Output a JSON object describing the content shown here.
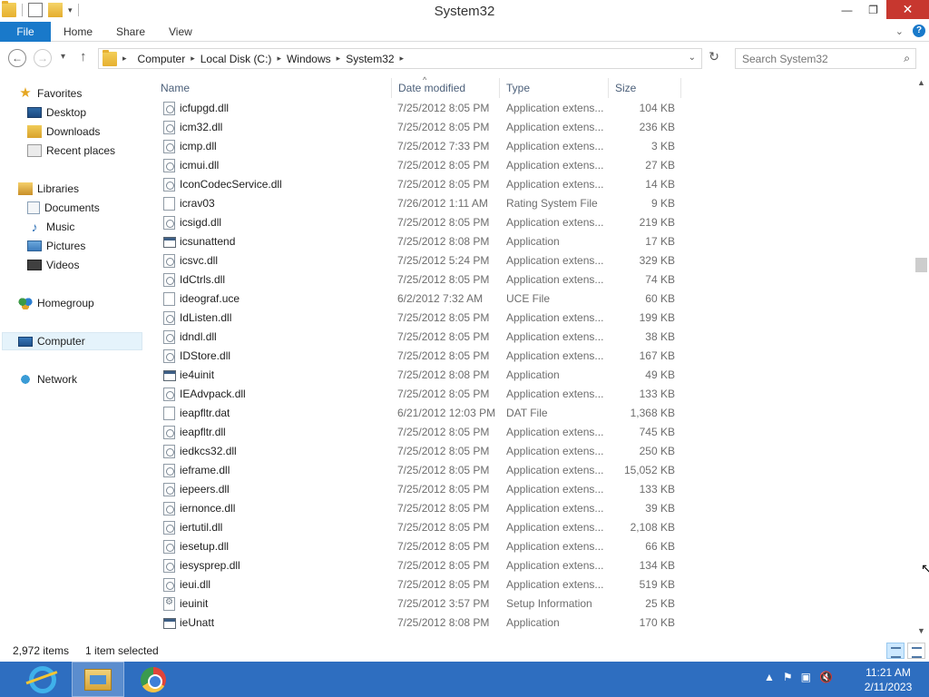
{
  "window": {
    "title": "System32",
    "controls": {
      "minimize": "—",
      "restore": "❐",
      "close": "✕"
    }
  },
  "ribbon": {
    "tabs": [
      {
        "label": "File"
      },
      {
        "label": "Home"
      },
      {
        "label": "Share"
      },
      {
        "label": "View"
      }
    ]
  },
  "address": {
    "crumbs": [
      "Computer",
      "Local Disk (C:)",
      "Windows",
      "System32"
    ]
  },
  "search": {
    "placeholder": "Search System32"
  },
  "nav": {
    "favorites": "Favorites",
    "desktop": "Desktop",
    "downloads": "Downloads",
    "recent": "Recent places",
    "libraries": "Libraries",
    "documents": "Documents",
    "music": "Music",
    "pictures": "Pictures",
    "videos": "Videos",
    "homegroup": "Homegroup",
    "computer": "Computer",
    "network": "Network"
  },
  "columns": {
    "name": "Name",
    "date": "Date modified",
    "type": "Type",
    "size": "Size"
  },
  "files": [
    {
      "name": "icfupgd.dll",
      "date": "7/25/2012 8:05 PM",
      "type": "Application extens...",
      "size": "104 KB",
      "icon": "dll"
    },
    {
      "name": "icm32.dll",
      "date": "7/25/2012 8:05 PM",
      "type": "Application extens...",
      "size": "236 KB",
      "icon": "dll"
    },
    {
      "name": "icmp.dll",
      "date": "7/25/2012 7:33 PM",
      "type": "Application extens...",
      "size": "3 KB",
      "icon": "dll"
    },
    {
      "name": "icmui.dll",
      "date": "7/25/2012 8:05 PM",
      "type": "Application extens...",
      "size": "27 KB",
      "icon": "dll"
    },
    {
      "name": "IconCodecService.dll",
      "date": "7/25/2012 8:05 PM",
      "type": "Application extens...",
      "size": "14 KB",
      "icon": "dll"
    },
    {
      "name": "icrav03",
      "date": "7/26/2012 1:11 AM",
      "type": "Rating System File",
      "size": "9 KB",
      "icon": "file"
    },
    {
      "name": "icsigd.dll",
      "date": "7/25/2012 8:05 PM",
      "type": "Application extens...",
      "size": "219 KB",
      "icon": "dll"
    },
    {
      "name": "icsunattend",
      "date": "7/25/2012 8:08 PM",
      "type": "Application",
      "size": "17 KB",
      "icon": "app"
    },
    {
      "name": "icsvc.dll",
      "date": "7/25/2012 5:24 PM",
      "type": "Application extens...",
      "size": "329 KB",
      "icon": "dll"
    },
    {
      "name": "IdCtrls.dll",
      "date": "7/25/2012 8:05 PM",
      "type": "Application extens...",
      "size": "74 KB",
      "icon": "dll"
    },
    {
      "name": "ideograf.uce",
      "date": "6/2/2012 7:32 AM",
      "type": "UCE File",
      "size": "60 KB",
      "icon": "file"
    },
    {
      "name": "IdListen.dll",
      "date": "7/25/2012 8:05 PM",
      "type": "Application extens...",
      "size": "199 KB",
      "icon": "dll"
    },
    {
      "name": "idndl.dll",
      "date": "7/25/2012 8:05 PM",
      "type": "Application extens...",
      "size": "38 KB",
      "icon": "dll"
    },
    {
      "name": "IDStore.dll",
      "date": "7/25/2012 8:05 PM",
      "type": "Application extens...",
      "size": "167 KB",
      "icon": "dll"
    },
    {
      "name": "ie4uinit",
      "date": "7/25/2012 8:08 PM",
      "type": "Application",
      "size": "49 KB",
      "icon": "app"
    },
    {
      "name": "IEAdvpack.dll",
      "date": "7/25/2012 8:05 PM",
      "type": "Application extens...",
      "size": "133 KB",
      "icon": "dll"
    },
    {
      "name": "ieapfltr.dat",
      "date": "6/21/2012 12:03 PM",
      "type": "DAT File",
      "size": "1,368 KB",
      "icon": "file"
    },
    {
      "name": "ieapfltr.dll",
      "date": "7/25/2012 8:05 PM",
      "type": "Application extens...",
      "size": "745 KB",
      "icon": "dll"
    },
    {
      "name": "iedkcs32.dll",
      "date": "7/25/2012 8:05 PM",
      "type": "Application extens...",
      "size": "250 KB",
      "icon": "dll"
    },
    {
      "name": "ieframe.dll",
      "date": "7/25/2012 8:05 PM",
      "type": "Application extens...",
      "size": "15,052 KB",
      "icon": "dll"
    },
    {
      "name": "iepeers.dll",
      "date": "7/25/2012 8:05 PM",
      "type": "Application extens...",
      "size": "133 KB",
      "icon": "dll"
    },
    {
      "name": "iernonce.dll",
      "date": "7/25/2012 8:05 PM",
      "type": "Application extens...",
      "size": "39 KB",
      "icon": "dll"
    },
    {
      "name": "iertutil.dll",
      "date": "7/25/2012 8:05 PM",
      "type": "Application extens...",
      "size": "2,108 KB",
      "icon": "dll"
    },
    {
      "name": "iesetup.dll",
      "date": "7/25/2012 8:05 PM",
      "type": "Application extens...",
      "size": "66 KB",
      "icon": "dll"
    },
    {
      "name": "iesysprep.dll",
      "date": "7/25/2012 8:05 PM",
      "type": "Application extens...",
      "size": "134 KB",
      "icon": "dll"
    },
    {
      "name": "ieui.dll",
      "date": "7/25/2012 8:05 PM",
      "type": "Application extens...",
      "size": "519 KB",
      "icon": "dll"
    },
    {
      "name": "ieuinit",
      "date": "7/25/2012 3:57 PM",
      "type": "Setup Information",
      "size": "25 KB",
      "icon": "inf"
    },
    {
      "name": "ieUnatt",
      "date": "7/25/2012 8:08 PM",
      "type": "Application",
      "size": "170 KB",
      "icon": "app"
    }
  ],
  "status": {
    "count": "2,972 items",
    "selected": "1 item selected"
  },
  "taskbar": {
    "clock_time": "11:21 AM",
    "clock_date": "2/11/2023"
  }
}
